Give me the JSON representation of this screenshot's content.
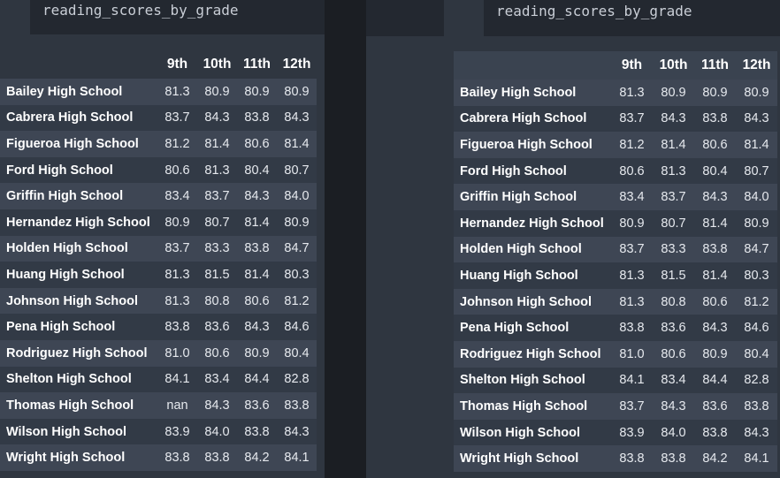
{
  "left": {
    "code": "reading_scores_by_grade",
    "columns": [
      "9th",
      "10th",
      "11th",
      "12th"
    ],
    "rows": [
      {
        "school": "Bailey High School",
        "values": [
          "81.3",
          "80.9",
          "80.9",
          "80.9"
        ]
      },
      {
        "school": "Cabrera High School",
        "values": [
          "83.7",
          "84.3",
          "83.8",
          "84.3"
        ]
      },
      {
        "school": "Figueroa High School",
        "values": [
          "81.2",
          "81.4",
          "80.6",
          "81.4"
        ]
      },
      {
        "school": "Ford High School",
        "values": [
          "80.6",
          "81.3",
          "80.4",
          "80.7"
        ]
      },
      {
        "school": "Griffin High School",
        "values": [
          "83.4",
          "83.7",
          "84.3",
          "84.0"
        ]
      },
      {
        "school": "Hernandez High School",
        "values": [
          "80.9",
          "80.7",
          "81.4",
          "80.9"
        ]
      },
      {
        "school": "Holden High School",
        "values": [
          "83.7",
          "83.3",
          "83.8",
          "84.7"
        ]
      },
      {
        "school": "Huang High School",
        "values": [
          "81.3",
          "81.5",
          "81.4",
          "80.3"
        ]
      },
      {
        "school": "Johnson High School",
        "values": [
          "81.3",
          "80.8",
          "80.6",
          "81.2"
        ]
      },
      {
        "school": "Pena High School",
        "values": [
          "83.8",
          "83.6",
          "84.3",
          "84.6"
        ]
      },
      {
        "school": "Rodriguez High School",
        "values": [
          "81.0",
          "80.6",
          "80.9",
          "80.4"
        ]
      },
      {
        "school": "Shelton High School",
        "values": [
          "84.1",
          "83.4",
          "84.4",
          "82.8"
        ]
      },
      {
        "school": "Thomas High School",
        "values": [
          "nan",
          "84.3",
          "83.6",
          "83.8"
        ]
      },
      {
        "school": "Wilson High School",
        "values": [
          "83.9",
          "84.0",
          "83.8",
          "84.3"
        ]
      },
      {
        "school": "Wright High School",
        "values": [
          "83.8",
          "83.8",
          "84.2",
          "84.1"
        ]
      }
    ]
  },
  "right": {
    "code": "reading_scores_by_grade",
    "columns": [
      "9th",
      "10th",
      "11th",
      "12th"
    ],
    "rows": [
      {
        "school": "Bailey High School",
        "values": [
          "81.3",
          "80.9",
          "80.9",
          "80.9"
        ]
      },
      {
        "school": "Cabrera High School",
        "values": [
          "83.7",
          "84.3",
          "83.8",
          "84.3"
        ]
      },
      {
        "school": "Figueroa High School",
        "values": [
          "81.2",
          "81.4",
          "80.6",
          "81.4"
        ]
      },
      {
        "school": "Ford High School",
        "values": [
          "80.6",
          "81.3",
          "80.4",
          "80.7"
        ]
      },
      {
        "school": "Griffin High School",
        "values": [
          "83.4",
          "83.7",
          "84.3",
          "84.0"
        ]
      },
      {
        "school": "Hernandez High School",
        "values": [
          "80.9",
          "80.7",
          "81.4",
          "80.9"
        ]
      },
      {
        "school": "Holden High School",
        "values": [
          "83.7",
          "83.3",
          "83.8",
          "84.7"
        ]
      },
      {
        "school": "Huang High School",
        "values": [
          "81.3",
          "81.5",
          "81.4",
          "80.3"
        ]
      },
      {
        "school": "Johnson High School",
        "values": [
          "81.3",
          "80.8",
          "80.6",
          "81.2"
        ]
      },
      {
        "school": "Pena High School",
        "values": [
          "83.8",
          "83.6",
          "84.3",
          "84.6"
        ]
      },
      {
        "school": "Rodriguez High School",
        "values": [
          "81.0",
          "80.6",
          "80.9",
          "80.4"
        ]
      },
      {
        "school": "Shelton High School",
        "values": [
          "84.1",
          "83.4",
          "84.4",
          "82.8"
        ]
      },
      {
        "school": "Thomas High School",
        "values": [
          "83.7",
          "84.3",
          "83.6",
          "83.8"
        ]
      },
      {
        "school": "Wilson High School",
        "values": [
          "83.9",
          "84.0",
          "83.8",
          "84.3"
        ]
      },
      {
        "school": "Wright High School",
        "values": [
          "83.8",
          "83.8",
          "84.2",
          "84.1"
        ]
      }
    ]
  }
}
